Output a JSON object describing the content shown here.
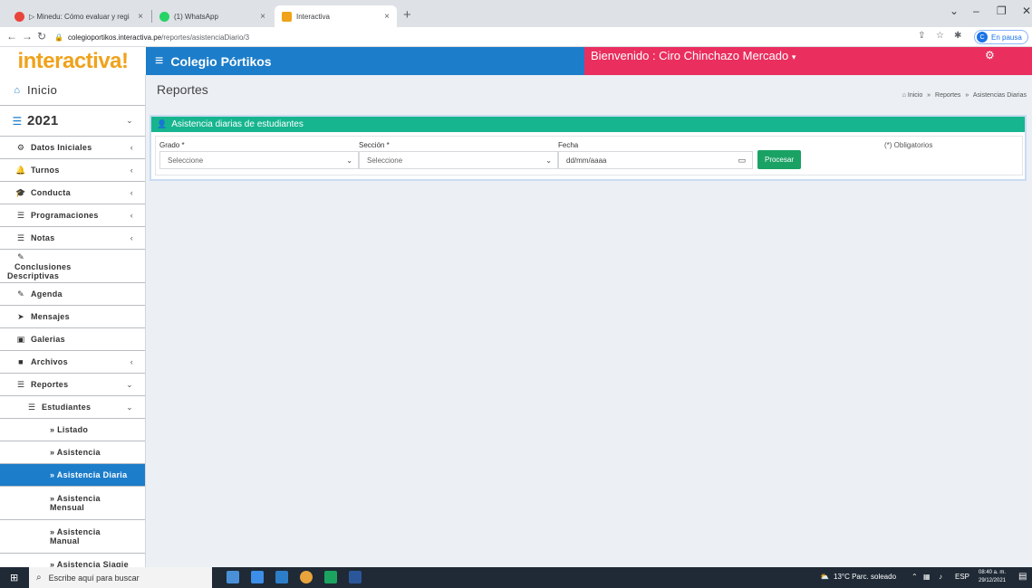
{
  "browser": {
    "tabs": [
      {
        "title": "▷ Minedu: Cómo evaluar y regi",
        "color": "#e8453c"
      },
      {
        "title": "(1) WhatsApp",
        "color": "#25d366"
      },
      {
        "title": "Interactiva",
        "color": "#f0a21b"
      }
    ],
    "tab_close": "×",
    "new_tab": "+",
    "url_domain": "colegioportikos.interactiva.pe",
    "url_path": "/reportes/asistenciaDiario/3",
    "paused_label": "En pausa",
    "avatar_letter": "C"
  },
  "header": {
    "logo": "interactiva!",
    "school": "Colegio Pórtikos",
    "welcome": "Bienvenido : Ciro Chinchazo Mercado",
    "welcome_caret": "▾"
  },
  "sidebar": {
    "home": "Inicio",
    "year": "2021",
    "items": [
      {
        "label": "Datos Iniciales",
        "icon": "⚙",
        "arrow": "‹"
      },
      {
        "label": "Turnos",
        "icon": "🔔",
        "arrow": "‹"
      },
      {
        "label": "Conducta",
        "icon": "🎓",
        "arrow": "‹"
      },
      {
        "label": "Programaciones",
        "icon": "☰",
        "arrow": "‹"
      },
      {
        "label": "Notas",
        "icon": "☰",
        "arrow": "‹"
      },
      {
        "label_1": "Conclusiones",
        "label_2": "Descriptivas",
        "icon": "✎"
      },
      {
        "label": "Agenda",
        "icon": "✎"
      },
      {
        "label": "Mensajes",
        "icon": "➤"
      },
      {
        "label": "Galerias",
        "icon": "▣"
      },
      {
        "label": "Archivos",
        "icon": "■",
        "arrow": "‹"
      },
      {
        "label": "Reportes",
        "icon": "☰",
        "arrow": "⌄"
      },
      {
        "label": "Estudiantes",
        "icon": "☰",
        "arrow": "⌄"
      },
      {
        "label": "» Listado"
      },
      {
        "label": "» Asistencia"
      },
      {
        "label": "» Asistencia Diaria"
      },
      {
        "label_1": "» Asistencia",
        "label_2": "Mensual"
      },
      {
        "label_1": "» Asistencia",
        "label_2": "Manual"
      },
      {
        "label": "» Asistencia Siagie"
      }
    ]
  },
  "content": {
    "title": "Reportes",
    "breadcrumb": [
      "Inicio",
      "Reportes",
      "Asistencias Diarias"
    ],
    "breadcrumb_sep": "»",
    "panel_title": "Asistencia diarias de estudiantes",
    "form": {
      "grado_label": "Grado *",
      "grado_value": "Seleccione",
      "seccion_label": "Sección *",
      "seccion_value": "Seleccione",
      "fecha_label": "Fecha",
      "fecha_placeholder": "dd/mm/aaaa",
      "process_button": "Procesar",
      "required_note": "(*) Obligatorios"
    }
  },
  "taskbar": {
    "search_placeholder": "Escribe aquí para buscar",
    "weather": "13°C  Parc. soleado",
    "lang": "ESP",
    "time": "08:40 a. m.",
    "date": "29/12/2021"
  }
}
